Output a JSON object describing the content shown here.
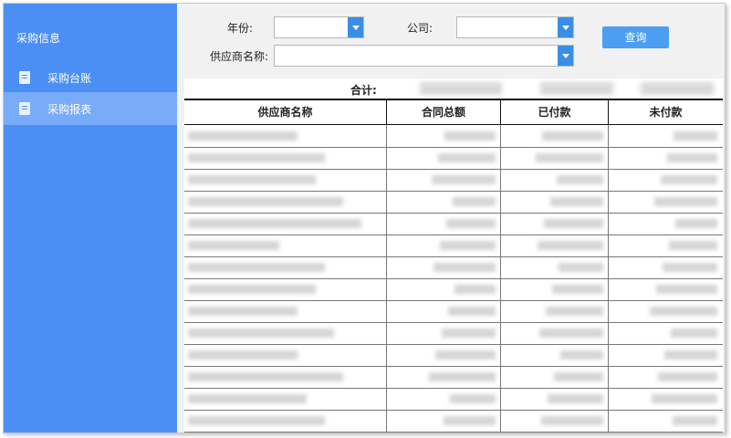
{
  "sidebar": {
    "title": "采购信息",
    "items": [
      {
        "label": "采购台账",
        "active": false
      },
      {
        "label": "采购报表",
        "active": true
      }
    ]
  },
  "filters": {
    "year_label": "年份:",
    "year_value": "",
    "company_label": "公司:",
    "company_value": "",
    "supplier_label": "供应商名称:",
    "supplier_value": ""
  },
  "query_button": "查询",
  "table": {
    "total_label": "合计:",
    "headers": [
      "供应商名称",
      "合同总额",
      "已付款",
      "未付款"
    ],
    "row_count": 14
  },
  "colors": {
    "sidebar": "#4b8ff5",
    "sidebar_active": "#79acf8",
    "button": "#4b9ef2",
    "dropdown_arrow": "#3a8ee6"
  }
}
